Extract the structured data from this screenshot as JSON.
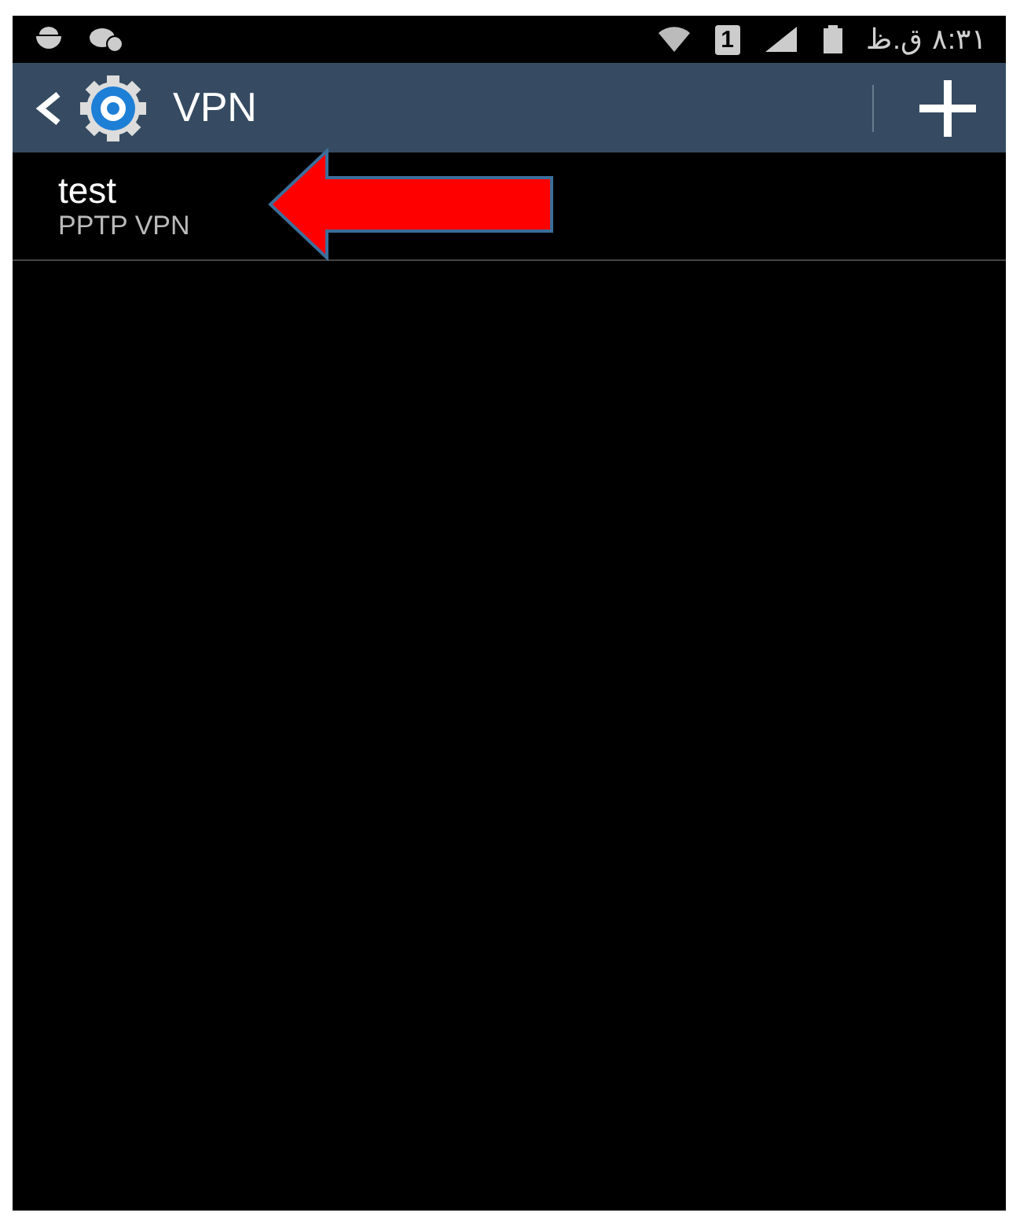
{
  "status_bar": {
    "sim_slot": "1",
    "am_pm": "ق.ظ",
    "time": "٨:٣١"
  },
  "action_bar": {
    "title": "VPN"
  },
  "vpn_list": [
    {
      "name": "test",
      "type": "PPTP VPN"
    }
  ]
}
